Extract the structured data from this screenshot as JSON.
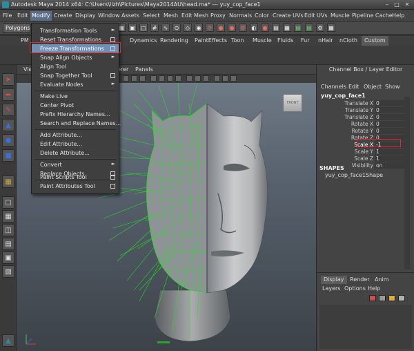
{
  "window": {
    "title": "Autodesk Maya 2014 x64: C:\\Users\\lizh\\Pictures\\Maya2014AU\\head.ma*   ---   yuy_cop_face1",
    "minimize": "–",
    "maximize": "□",
    "close": "✕"
  },
  "menubar": [
    "File",
    "Edit",
    "Modify",
    "Create",
    "Display",
    "Window",
    "Assets",
    "Select",
    "Mesh",
    "Edit Mesh",
    "Proxy",
    "Normals",
    "Color",
    "Create UVs",
    "Edit UVs",
    "Muscle",
    "Pipeline Cache",
    "Help"
  ],
  "status_line": {
    "mode": "Polygons"
  },
  "shelf_tabs": [
    "Dynamics",
    "Rendering",
    "PaintEffects",
    "Toon",
    "Muscle",
    "Fluids",
    "Fur",
    "nHair",
    "nCloth",
    "Custom"
  ],
  "shelf_partial": {
    "clipped_tab": "PM",
    "panel_fragment": "Vie",
    "renderer_fragment": "erer"
  },
  "panel_menu": [
    "Panels"
  ],
  "viewcube_label": "FRONT",
  "modify_menu": {
    "items": [
      {
        "label": "Transformation Tools",
        "marker": "arrow"
      },
      {
        "label": "Reset Transformations",
        "marker": "box"
      },
      {
        "label": "Freeze Transformations",
        "marker": "box",
        "selected": true
      },
      {
        "label": "Snap Align Objects",
        "marker": "arrow"
      },
      {
        "label": "Align Tool",
        "marker": ""
      },
      {
        "label": "Snap Together Tool",
        "marker": "box"
      },
      {
        "label": "Evaluate Nodes",
        "marker": "arrow"
      },
      {
        "label": "Make Live",
        "marker": ""
      },
      {
        "label": "Center Pivot",
        "marker": ""
      },
      {
        "label": "Prefix Hierarchy Names...",
        "marker": ""
      },
      {
        "label": "Search and Replace Names...",
        "marker": ""
      },
      {
        "label": "Add Attribute...",
        "marker": ""
      },
      {
        "label": "Edit Attribute...",
        "marker": ""
      },
      {
        "label": "Delete Attribute...",
        "marker": ""
      },
      {
        "label": "Convert",
        "marker": "arrow"
      },
      {
        "label": "Replace Objects",
        "marker": "box"
      },
      {
        "label": "Paint Scripts Tool",
        "marker": "box"
      },
      {
        "label": "Paint Attributes Tool",
        "marker": "box"
      }
    ]
  },
  "channel_box": {
    "header": "Channel Box / Layer Editor",
    "tabs": [
      "Channels",
      "Edit",
      "Object",
      "Show"
    ],
    "object_name": "yuy_cop_face1",
    "attributes": [
      {
        "name": "Translate X",
        "value": "0"
      },
      {
        "name": "Translate Y",
        "value": "0"
      },
      {
        "name": "Translate Z",
        "value": "0"
      },
      {
        "name": "Rotate X",
        "value": "0"
      },
      {
        "name": "Rotate Y",
        "value": "0"
      },
      {
        "name": "Rotate Z",
        "value": "0"
      },
      {
        "name": "Scale X",
        "value": "-1",
        "highlighted": true
      },
      {
        "name": "Scale Y",
        "value": "1"
      },
      {
        "name": "Scale Z",
        "value": "1"
      },
      {
        "name": "Visibility",
        "value": "on"
      }
    ],
    "shapes_label": "SHAPES",
    "shape_name": "yuy_cop_face1Shape"
  },
  "layer_editor": {
    "tabs": [
      "Display",
      "Render",
      "Anim"
    ],
    "menu": [
      "Layers",
      "Options",
      "Help"
    ]
  },
  "colors": {
    "accent_highlight": "#6f8fb3",
    "annotation_red": "#e8242a",
    "wireframe_green": "#22e622"
  }
}
